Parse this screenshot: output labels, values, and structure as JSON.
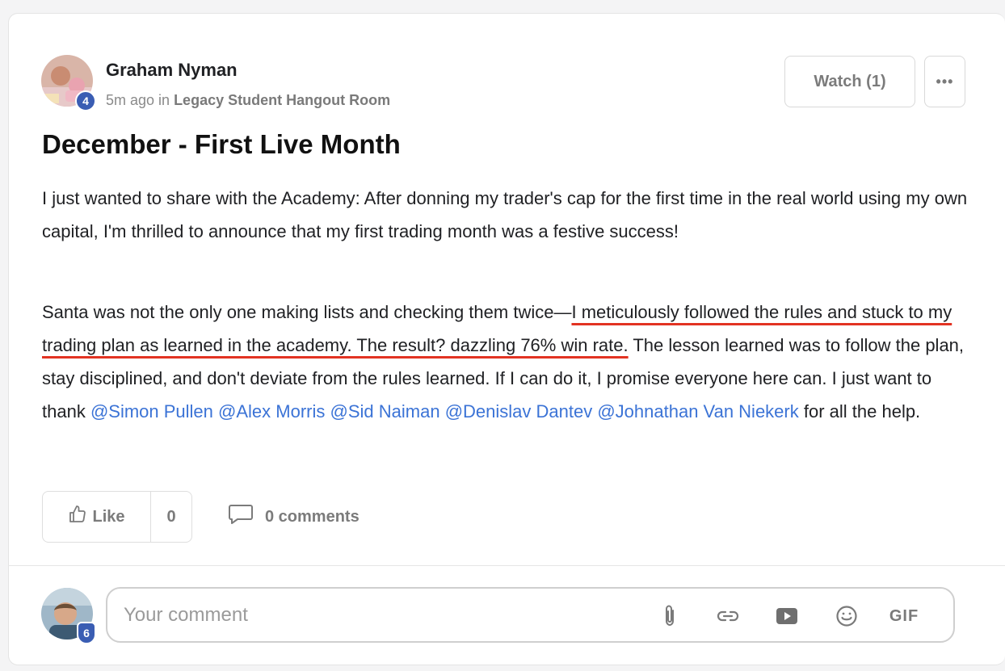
{
  "post": {
    "author": {
      "name": "Graham Nyman",
      "level": "4"
    },
    "meta": {
      "time": "5m ago in ",
      "room": "Legacy Student Hangout Room"
    },
    "watch_label": "Watch (1)",
    "more_label": "•••",
    "title": "December - First Live Month",
    "paragraph1": "I just wanted to share with the Academy: After donning my trader's cap for the first time in the real world using my own capital, I'm thrilled to announce that my first trading month was a festive success!",
    "paragraph2": {
      "intro": "Santa was not the only one making lists and checking them twice—",
      "highlighted": "I meticulously followed the rules and stuck to my trading plan as learned in the academy. The result? dazzling 76% win rate.",
      "rest": " The lesson learned was to follow the plan, stay disciplined, and don't deviate from the rules learned. If I can do it, I promise everyone here can. I just want to thank ",
      "mentions": [
        "@Simon Pullen",
        "@Alex Morris",
        "@Sid Naiman",
        "@Denislav Dantev",
        "@Johnathan Van Niekerk"
      ],
      "closing": " for all the help."
    },
    "like_label": "Like",
    "like_count": "0",
    "comments_label": "0 comments"
  },
  "composer": {
    "user_level": "6",
    "placeholder": "Your comment",
    "gif_label": "GIF"
  },
  "colors": {
    "mention": "#3b73d6",
    "highlight_underline": "#e23322",
    "badge": "#3a5db3"
  },
  "icons": [
    "thumbs-up-icon",
    "comment-bubble-icon",
    "attachment-icon",
    "link-icon",
    "video-icon",
    "emoji-icon",
    "gif-icon",
    "more-dots-icon"
  ]
}
